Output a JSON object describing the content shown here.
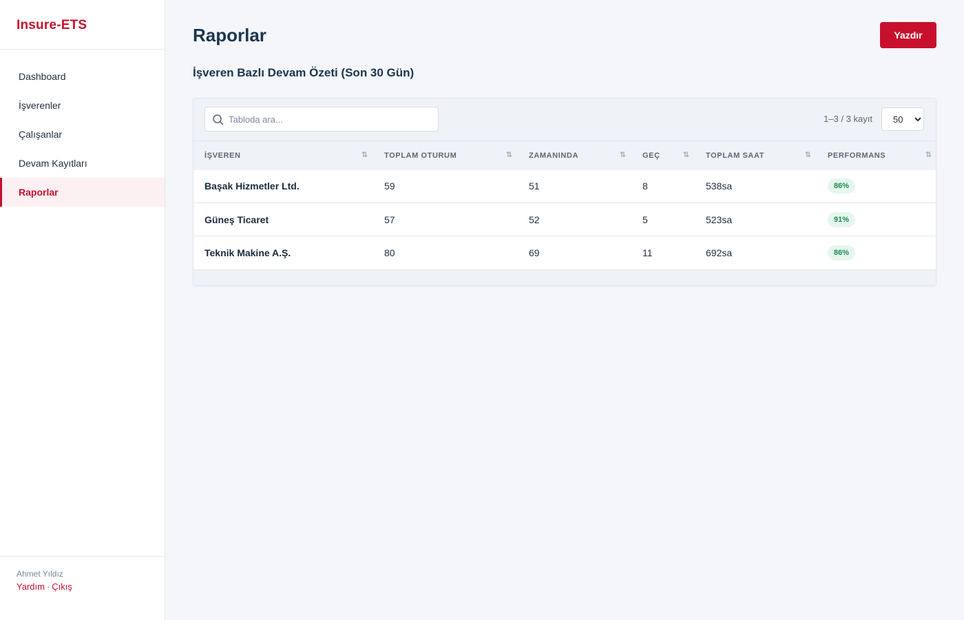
{
  "sidebar": {
    "brand": "Insure-ETS",
    "items": [
      {
        "label": "Dashboard"
      },
      {
        "label": "İşverenler"
      },
      {
        "label": "Çalışanlar"
      },
      {
        "label": "Devam Kayıtları"
      },
      {
        "label": "Raporlar",
        "active": true
      }
    ],
    "footer": {
      "user_name": "Ahmet Yıldız",
      "help_label": "Yardım",
      "separator": "·",
      "logout_label": "Çıkış"
    }
  },
  "header": {
    "title": "Raporlar",
    "print_label": "Yazdır"
  },
  "report": {
    "section_title": "İşveren Bazlı Devam Özeti (Son 30 Gün)",
    "search": {
      "placeholder": "Tabloda ara...",
      "value": ""
    },
    "range_text": "1–3 / 3 kayıt",
    "page_size": {
      "selected": "50"
    },
    "columns": [
      "İŞVEREN",
      "TOPLAM OTURUM",
      "ZAMANINDA",
      "GEÇ",
      "TOPLAM SAAT",
      "PERFORMANS"
    ],
    "rows": [
      {
        "employer": "Başak Hizmetler Ltd.",
        "total_sessions": "59",
        "on_time": "51",
        "late": "8",
        "total_hours": "538sa",
        "performance": "86%"
      },
      {
        "employer": "Güneş Ticaret",
        "total_sessions": "57",
        "on_time": "52",
        "late": "5",
        "total_hours": "523sa",
        "performance": "91%"
      },
      {
        "employer": "Teknik Makine A.Ş.",
        "total_sessions": "80",
        "on_time": "69",
        "late": "11",
        "total_hours": "692sa",
        "performance": "86%"
      }
    ]
  },
  "colors": {
    "accent": "#c8102e",
    "heading": "#1a3550",
    "badge_bg": "#e6f6ee",
    "badge_text": "#1a8a4e"
  },
  "icons": {
    "search": "search-icon",
    "sort": "sort-icon"
  }
}
